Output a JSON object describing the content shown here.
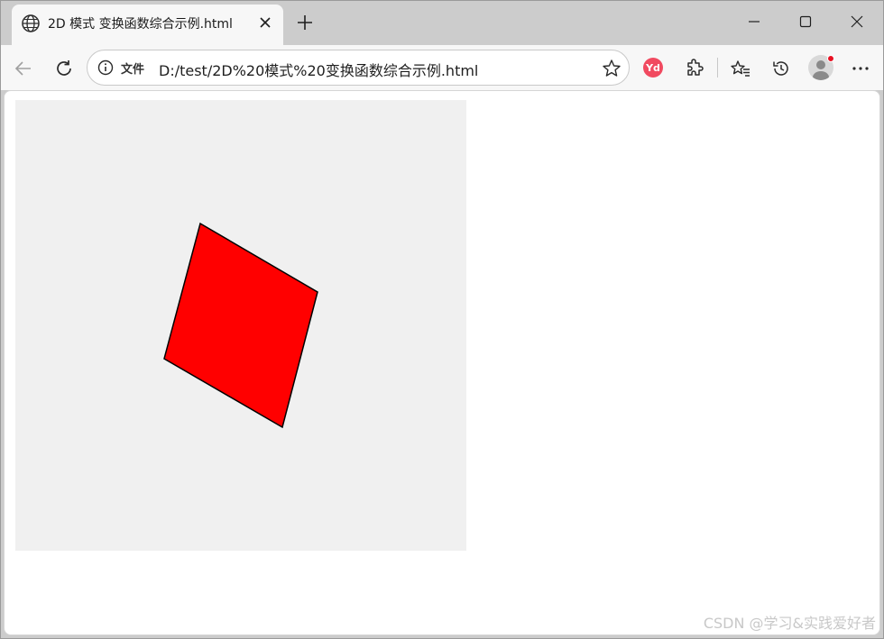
{
  "tab": {
    "title": "2D 模式 变换函数综合示例.html",
    "favicon": "globe-icon",
    "close_icon": "close-icon"
  },
  "window_controls": [
    "minimize-icon",
    "maximize-icon",
    "close-icon"
  ],
  "toolbar": {
    "back_icon": "back-arrow-icon",
    "reload_icon": "reload-icon",
    "address": {
      "info_icon": "info-icon",
      "label": "文件",
      "url": "D:/test/2D%20模式%20变换函数综合示例.html",
      "favorite_icon": "star-icon"
    },
    "extension_badge": "Yd",
    "extensions_icon": "puzzle-icon",
    "favorites_icon": "favorites-icon",
    "history_icon": "history-icon",
    "profile_icon": "avatar-icon",
    "menu_icon": "more-icon"
  },
  "page": {
    "stage_background": "#f0f0f0",
    "shape_fill": "#ff0000",
    "shape_stroke": "#000000"
  },
  "watermark": "CSDN @学习&实践爱好者"
}
